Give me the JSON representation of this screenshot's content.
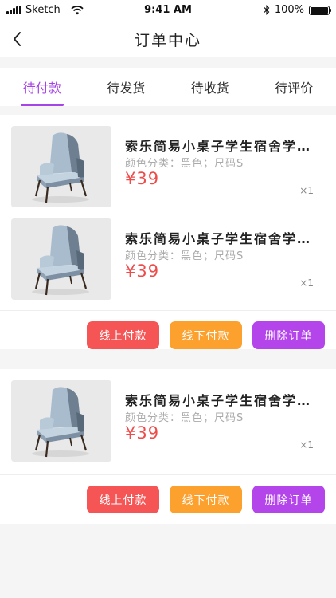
{
  "status_bar": {
    "carrier": "Sketch",
    "time": "9:41 AM",
    "battery": "100%",
    "battery_level": 1.0
  },
  "header": {
    "title": "订单中心"
  },
  "tabs": [
    {
      "label": "待付款",
      "active": true
    },
    {
      "label": "待发货",
      "active": false
    },
    {
      "label": "待收货",
      "active": false
    },
    {
      "label": "待评价",
      "active": false
    }
  ],
  "orders": [
    {
      "items": [
        {
          "title": "索乐简易小桌子学生宿舍学生宿舍",
          "spec": "颜色分类：黑色；尺码S",
          "price": "¥39",
          "qty": "×1"
        },
        {
          "title": "索乐简易小桌子学生宿舍学生宿舍",
          "spec": "颜色分类：黑色；尺码S",
          "price": "¥39",
          "qty": "×1"
        }
      ],
      "actions": {
        "online_pay": "线上付款",
        "offline_pay": "线下付款",
        "delete": "删除订单"
      }
    },
    {
      "items": [
        {
          "title": "索乐简易小桌子学生宿舍学生宿舍",
          "spec": "颜色分类：黑色；尺码S",
          "price": "¥39",
          "qty": "×1"
        }
      ],
      "actions": {
        "online_pay": "线上付款",
        "offline_pay": "线下付款",
        "delete": "删除订单"
      }
    }
  ],
  "colors": {
    "accent": "#a744e6",
    "price": "#ee4b4b",
    "btn_online": "#f55555",
    "btn_offline": "#fca12e",
    "btn_delete": "#b345ea"
  },
  "icons": {
    "back": "chevron-left-icon",
    "wifi": "wifi-icon",
    "bluetooth": "bluetooth-icon",
    "battery": "battery-icon",
    "signal": "signal-icon"
  }
}
